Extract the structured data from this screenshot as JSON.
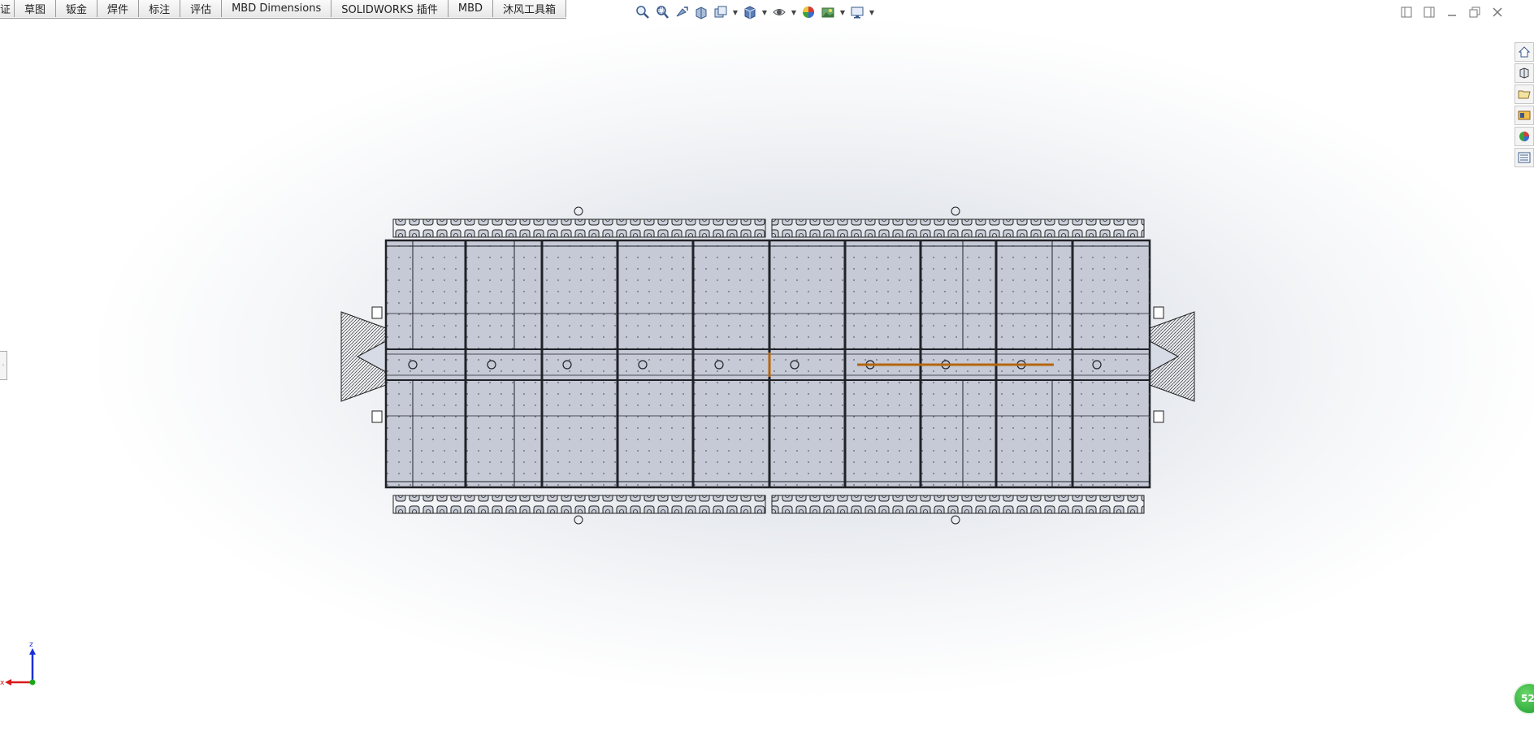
{
  "command_tabs": [
    {
      "label": "证"
    },
    {
      "label": "草图"
    },
    {
      "label": "钣金"
    },
    {
      "label": "焊件"
    },
    {
      "label": "标注"
    },
    {
      "label": "评估"
    },
    {
      "label": "MBD Dimensions"
    },
    {
      "label": "SOLIDWORKS 插件"
    },
    {
      "label": "MBD"
    },
    {
      "label": "沐风工具箱"
    }
  ],
  "heads_up_toolbar": [
    "zoom-to-fit-icon",
    "zoom-to-area-icon",
    "previous-view-icon",
    "section-view-icon",
    "dynamic-annotation-view-icon",
    "view-orientation-icon",
    "display-style-icon",
    "hide-show-items-icon",
    "edit-appearance-icon",
    "apply-scene-icon",
    "view-settings-icon"
  ],
  "task_pane": [
    "home-icon",
    "resources-icon",
    "file-explorer-icon",
    "design-library-icon",
    "appearances-icon",
    "custom-properties-icon"
  ],
  "triad": {
    "z_label": "z",
    "x_label": "x"
  },
  "badge": {
    "text": "52"
  },
  "colors": {
    "model_fill": "#c5cad6",
    "model_line": "#202228",
    "highlight": "#b5650f",
    "triad_z": "#1a2fd8",
    "triad_x": "#d81a1a",
    "triad_origin": "#1aa81a"
  }
}
